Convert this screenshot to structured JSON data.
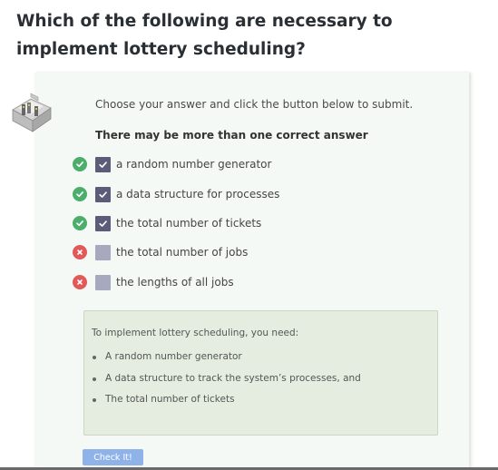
{
  "question": {
    "title": "Which of the following are necessary to implement lottery scheduling?"
  },
  "instructions": "Choose your answer and click the button below to submit.",
  "hint": "There may be more than one correct answer",
  "options": [
    {
      "label": "a random number generator",
      "checked": true,
      "result": "correct"
    },
    {
      "label": "a data structure for processes",
      "checked": true,
      "result": "correct"
    },
    {
      "label": "the total number of tickets",
      "checked": true,
      "result": "correct"
    },
    {
      "label": "the total number of jobs",
      "checked": false,
      "result": "incorrect"
    },
    {
      "label": "the lengths of all jobs",
      "checked": false,
      "result": "incorrect"
    }
  ],
  "feedback": {
    "intro": "To implement lottery scheduling, you need:",
    "items": [
      "A random number generator",
      "A data structure to track the system’s processes, and",
      "The total number of tickets"
    ]
  },
  "submit_button": "Check It!",
  "colors": {
    "correct": "#4cae6a",
    "incorrect": "#e15a5a",
    "checkbox_checked": "#5a5c7a",
    "checkbox_unchecked": "#a7a9bf",
    "feedback_bg": "#e4eddf",
    "button": "#8fb3e8"
  }
}
